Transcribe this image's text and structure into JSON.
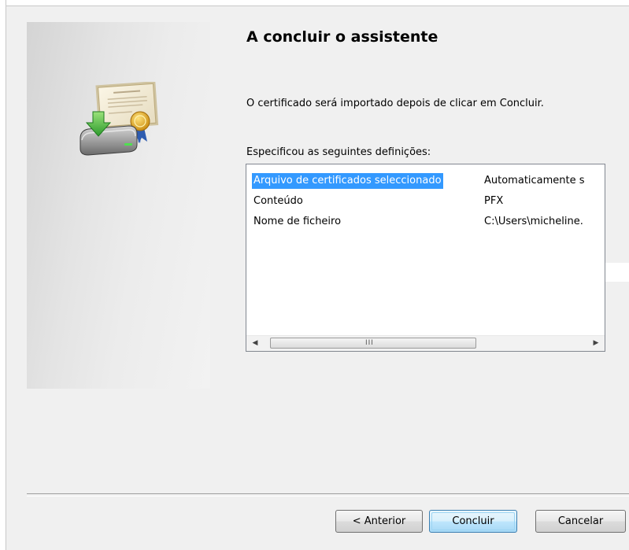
{
  "wizard": {
    "title": "A concluir o assistente",
    "description": "O certificado será importado depois de clicar em Concluir.",
    "list_caption": "Especificou as seguintes definições:"
  },
  "settings_list": {
    "rows": [
      {
        "name": "Arquivo de certificados seleccionado",
        "value": "Automaticamente s",
        "selected": true
      },
      {
        "name": "Conteúdo",
        "value": "PFX",
        "selected": false
      },
      {
        "name": "Nome de ficheiro",
        "value": "C:\\Users\\micheline.",
        "selected": false
      }
    ],
    "scrollbar": {
      "left_arrow": "◀",
      "right_arrow": "▶",
      "grip": "III"
    }
  },
  "buttons": {
    "back": "< Anterior",
    "finish": "Concluir",
    "cancel": "Cancelar"
  },
  "icons": {
    "wizard_image": "certificate-import-icon"
  },
  "colors": {
    "selection": "#3399ff",
    "default_button_border": "#3c7fb1"
  }
}
